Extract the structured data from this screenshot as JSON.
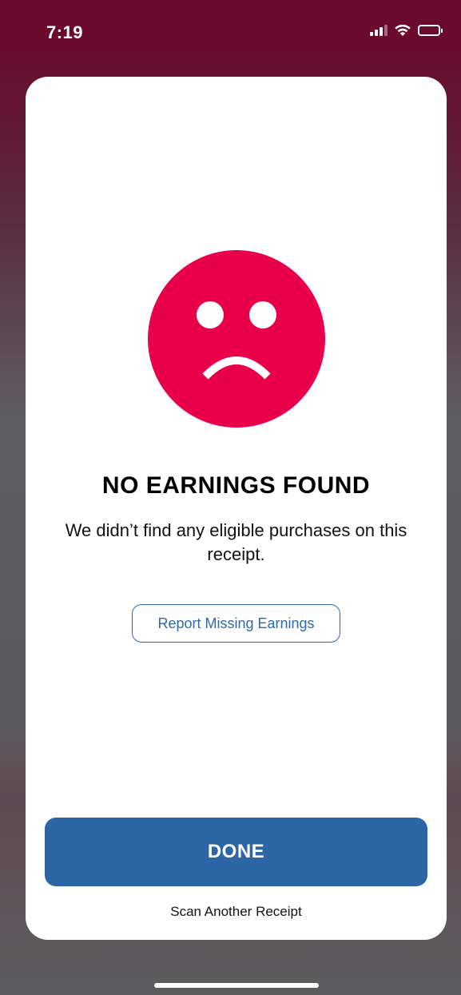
{
  "status_bar": {
    "time": "7:19",
    "icons": [
      "signal-icon",
      "wifi-icon",
      "battery-icon"
    ]
  },
  "result": {
    "icon": "sad-face-icon",
    "icon_color": "#e8004a",
    "headline": "NO EARNINGS FOUND",
    "message": "We didn’t find any eligible purchases on this receipt."
  },
  "actions": {
    "report_label": "Report Missing Earnings",
    "done_label": "DONE",
    "scan_another_label": "Scan Another Receipt"
  },
  "colors": {
    "primary": "#2c66a7",
    "accent": "#e8004a",
    "background_top": "#6a0a2d"
  }
}
